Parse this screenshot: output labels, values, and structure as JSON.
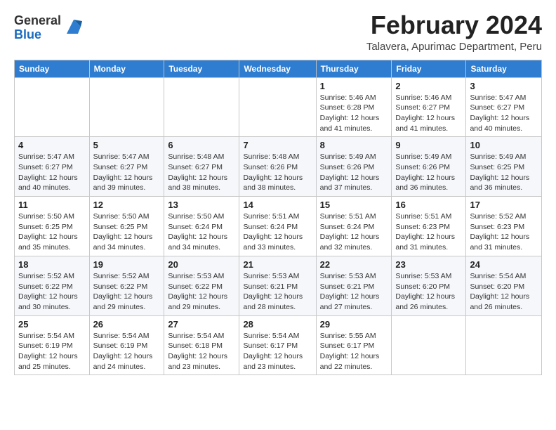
{
  "header": {
    "logo_general": "General",
    "logo_blue": "Blue",
    "month_year": "February 2024",
    "location": "Talavera, Apurimac Department, Peru"
  },
  "days_of_week": [
    "Sunday",
    "Monday",
    "Tuesday",
    "Wednesday",
    "Thursday",
    "Friday",
    "Saturday"
  ],
  "weeks": [
    [
      {
        "day": "",
        "info": ""
      },
      {
        "day": "",
        "info": ""
      },
      {
        "day": "",
        "info": ""
      },
      {
        "day": "",
        "info": ""
      },
      {
        "day": "1",
        "info": "Sunrise: 5:46 AM\nSunset: 6:28 PM\nDaylight: 12 hours\nand 41 minutes."
      },
      {
        "day": "2",
        "info": "Sunrise: 5:46 AM\nSunset: 6:27 PM\nDaylight: 12 hours\nand 41 minutes."
      },
      {
        "day": "3",
        "info": "Sunrise: 5:47 AM\nSunset: 6:27 PM\nDaylight: 12 hours\nand 40 minutes."
      }
    ],
    [
      {
        "day": "4",
        "info": "Sunrise: 5:47 AM\nSunset: 6:27 PM\nDaylight: 12 hours\nand 40 minutes."
      },
      {
        "day": "5",
        "info": "Sunrise: 5:47 AM\nSunset: 6:27 PM\nDaylight: 12 hours\nand 39 minutes."
      },
      {
        "day": "6",
        "info": "Sunrise: 5:48 AM\nSunset: 6:27 PM\nDaylight: 12 hours\nand 38 minutes."
      },
      {
        "day": "7",
        "info": "Sunrise: 5:48 AM\nSunset: 6:26 PM\nDaylight: 12 hours\nand 38 minutes."
      },
      {
        "day": "8",
        "info": "Sunrise: 5:49 AM\nSunset: 6:26 PM\nDaylight: 12 hours\nand 37 minutes."
      },
      {
        "day": "9",
        "info": "Sunrise: 5:49 AM\nSunset: 6:26 PM\nDaylight: 12 hours\nand 36 minutes."
      },
      {
        "day": "10",
        "info": "Sunrise: 5:49 AM\nSunset: 6:25 PM\nDaylight: 12 hours\nand 36 minutes."
      }
    ],
    [
      {
        "day": "11",
        "info": "Sunrise: 5:50 AM\nSunset: 6:25 PM\nDaylight: 12 hours\nand 35 minutes."
      },
      {
        "day": "12",
        "info": "Sunrise: 5:50 AM\nSunset: 6:25 PM\nDaylight: 12 hours\nand 34 minutes."
      },
      {
        "day": "13",
        "info": "Sunrise: 5:50 AM\nSunset: 6:24 PM\nDaylight: 12 hours\nand 34 minutes."
      },
      {
        "day": "14",
        "info": "Sunrise: 5:51 AM\nSunset: 6:24 PM\nDaylight: 12 hours\nand 33 minutes."
      },
      {
        "day": "15",
        "info": "Sunrise: 5:51 AM\nSunset: 6:24 PM\nDaylight: 12 hours\nand 32 minutes."
      },
      {
        "day": "16",
        "info": "Sunrise: 5:51 AM\nSunset: 6:23 PM\nDaylight: 12 hours\nand 31 minutes."
      },
      {
        "day": "17",
        "info": "Sunrise: 5:52 AM\nSunset: 6:23 PM\nDaylight: 12 hours\nand 31 minutes."
      }
    ],
    [
      {
        "day": "18",
        "info": "Sunrise: 5:52 AM\nSunset: 6:22 PM\nDaylight: 12 hours\nand 30 minutes."
      },
      {
        "day": "19",
        "info": "Sunrise: 5:52 AM\nSunset: 6:22 PM\nDaylight: 12 hours\nand 29 minutes."
      },
      {
        "day": "20",
        "info": "Sunrise: 5:53 AM\nSunset: 6:22 PM\nDaylight: 12 hours\nand 29 minutes."
      },
      {
        "day": "21",
        "info": "Sunrise: 5:53 AM\nSunset: 6:21 PM\nDaylight: 12 hours\nand 28 minutes."
      },
      {
        "day": "22",
        "info": "Sunrise: 5:53 AM\nSunset: 6:21 PM\nDaylight: 12 hours\nand 27 minutes."
      },
      {
        "day": "23",
        "info": "Sunrise: 5:53 AM\nSunset: 6:20 PM\nDaylight: 12 hours\nand 26 minutes."
      },
      {
        "day": "24",
        "info": "Sunrise: 5:54 AM\nSunset: 6:20 PM\nDaylight: 12 hours\nand 26 minutes."
      }
    ],
    [
      {
        "day": "25",
        "info": "Sunrise: 5:54 AM\nSunset: 6:19 PM\nDaylight: 12 hours\nand 25 minutes."
      },
      {
        "day": "26",
        "info": "Sunrise: 5:54 AM\nSunset: 6:19 PM\nDaylight: 12 hours\nand 24 minutes."
      },
      {
        "day": "27",
        "info": "Sunrise: 5:54 AM\nSunset: 6:18 PM\nDaylight: 12 hours\nand 23 minutes."
      },
      {
        "day": "28",
        "info": "Sunrise: 5:54 AM\nSunset: 6:17 PM\nDaylight: 12 hours\nand 23 minutes."
      },
      {
        "day": "29",
        "info": "Sunrise: 5:55 AM\nSunset: 6:17 PM\nDaylight: 12 hours\nand 22 minutes."
      },
      {
        "day": "",
        "info": ""
      },
      {
        "day": "",
        "info": ""
      }
    ]
  ]
}
